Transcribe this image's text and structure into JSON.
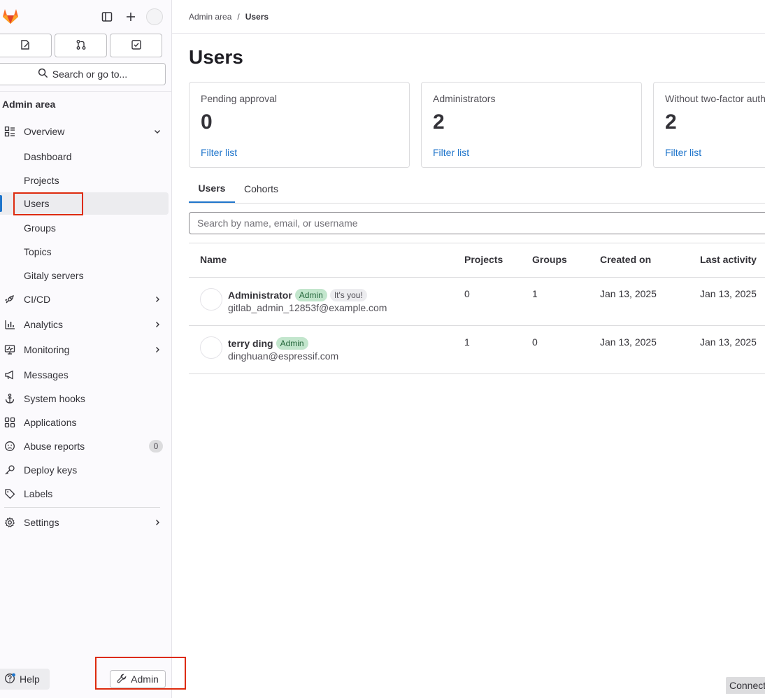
{
  "topbar": {
    "sidebar_toggle_icon": "sidebar-icon",
    "new_icon": "plus-icon"
  },
  "quick_actions": [
    {
      "name": "issues",
      "icon": "issues-icon"
    },
    {
      "name": "merge-requests",
      "icon": "merge-request-icon"
    },
    {
      "name": "todos",
      "icon": "todo-icon"
    }
  ],
  "search": {
    "label": "Search or go to..."
  },
  "sidebar": {
    "section_title": "Admin area",
    "overview_label": "Overview",
    "items": [
      {
        "label": "Dashboard"
      },
      {
        "label": "Projects"
      },
      {
        "label": "Users"
      },
      {
        "label": "Groups"
      },
      {
        "label": "Topics"
      },
      {
        "label": "Gitaly servers"
      },
      {
        "label": "CI/CD"
      },
      {
        "label": "Analytics"
      },
      {
        "label": "Monitoring"
      },
      {
        "label": "Messages"
      },
      {
        "label": "System hooks"
      },
      {
        "label": "Applications"
      },
      {
        "label": "Abuse reports",
        "count": "0"
      },
      {
        "label": "Deploy keys"
      },
      {
        "label": "Labels"
      },
      {
        "label": "Settings"
      }
    ],
    "help_label": "Help",
    "admin_label": "Admin"
  },
  "breadcrumb": {
    "parent": "Admin area",
    "separator": "/",
    "current": "Users"
  },
  "page": {
    "title": "Users"
  },
  "stats": [
    {
      "label": "Pending approval",
      "value": "0",
      "link": "Filter list"
    },
    {
      "label": "Administrators",
      "value": "2",
      "link": "Filter list"
    },
    {
      "label": "Without two-factor authentication",
      "value": "2",
      "link": "Filter list"
    }
  ],
  "tabs": [
    {
      "label": "Users"
    },
    {
      "label": "Cohorts"
    }
  ],
  "user_search": {
    "placeholder": "Search by name, email, or username"
  },
  "table": {
    "headers": [
      "Name",
      "Projects",
      "Groups",
      "Created on",
      "Last activity"
    ],
    "rows": [
      {
        "name": "Administrator",
        "badges": [
          "Admin",
          "It's you!"
        ],
        "email": "gitlab_admin_12853f@example.com",
        "projects": "0",
        "groups": "1",
        "created": "Jan 13, 2025",
        "last_activity": "Jan 13, 2025"
      },
      {
        "name": "terry ding",
        "badges": [
          "Admin"
        ],
        "email": "dinghuan@espressif.com",
        "projects": "1",
        "groups": "0",
        "created": "Jan 13, 2025",
        "last_activity": "Jan 13, 2025"
      }
    ]
  },
  "status": {
    "connect": "Connecting..."
  },
  "colors": {
    "accent": "#1f75cb",
    "highlight_box": "#dd2b0e",
    "admin_badge_bg": "#c3e6cd"
  }
}
